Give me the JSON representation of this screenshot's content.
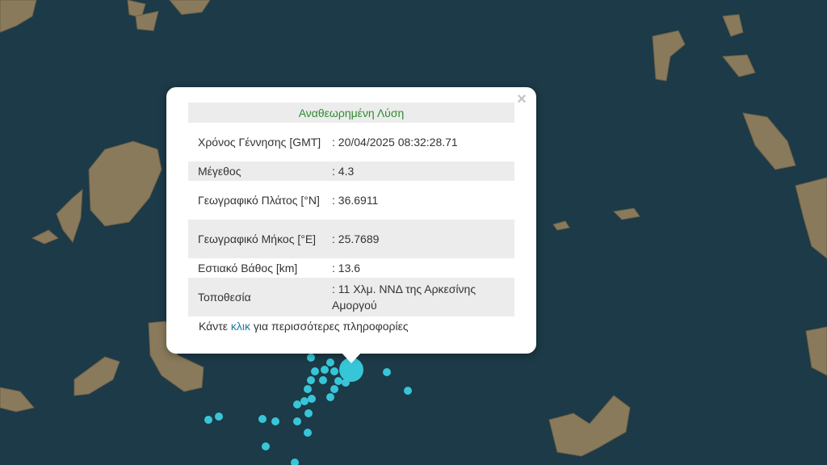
{
  "popup": {
    "title": "Αναθεωρημένη Λύση",
    "close_symbol": "×",
    "rows": [
      {
        "label": "Χρόνος Γέννησης [GMT]",
        "value": ": 20/04/2025 08:32:28.71"
      },
      {
        "label": "Μέγεθος",
        "value": ": 4.3"
      },
      {
        "label": "Γεωγραφικό Πλάτος [°N]",
        "value": ": 36.6911"
      },
      {
        "label": "Γεωγραφικό Μήκος [°E]",
        "value": ": 25.7689"
      },
      {
        "label": "Εστιακό Βάθος [km]",
        "value": ": 13.6"
      },
      {
        "label": "Τοποθεσία",
        "value": ": 11 Χλμ. ΝΝΔ της Αρκεσίνης Αμοργού"
      }
    ],
    "more_prefix": "Κάντε ",
    "more_link": "κλικ",
    "more_suffix": " για περισσότερες πληροφορίες"
  },
  "map": {
    "sea_color": "#1c3a47",
    "land_color": "#8a7a5c",
    "marker_color": "#37c6d8"
  }
}
